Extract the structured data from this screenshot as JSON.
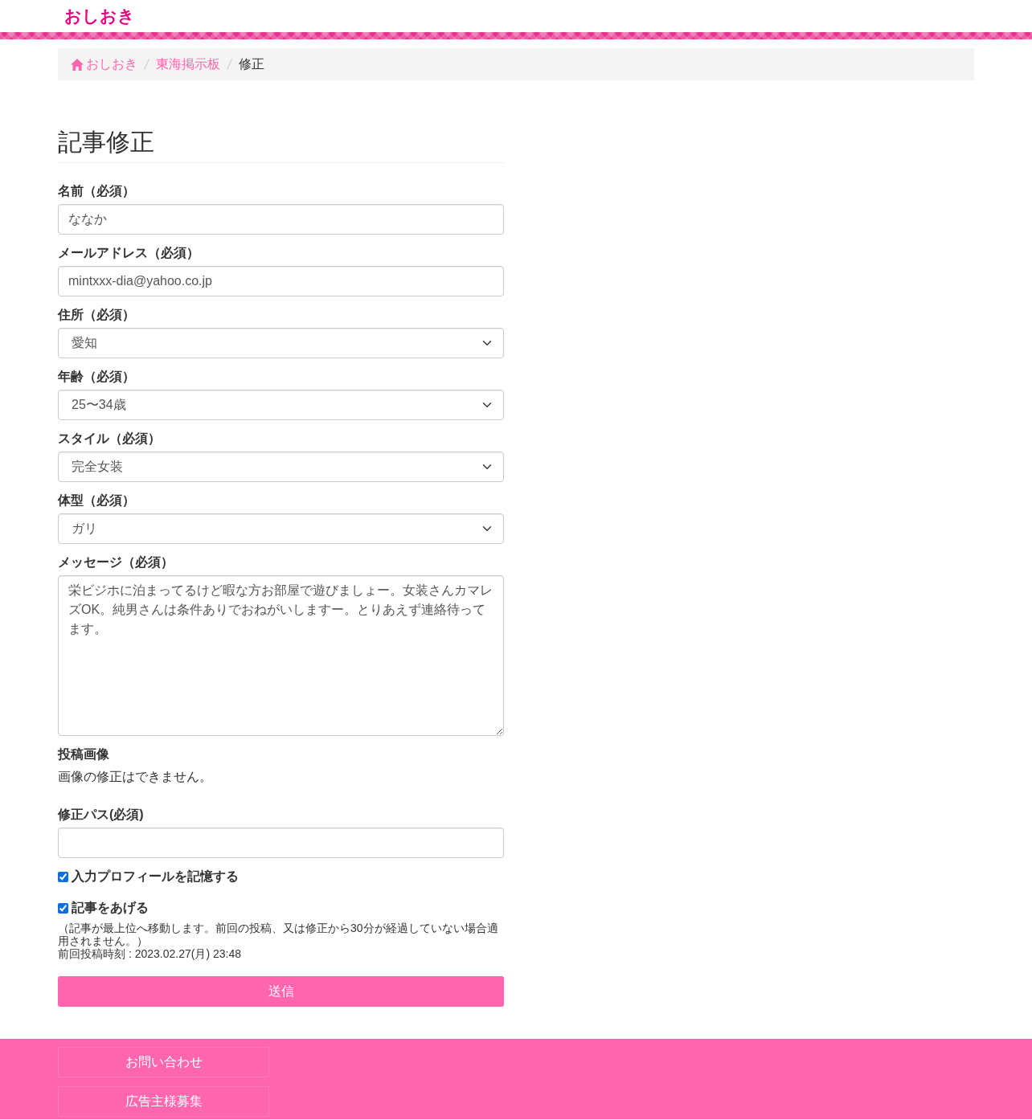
{
  "header": {
    "logo": "おしおき"
  },
  "breadcrumb": [
    {
      "label": "おしおき",
      "kind": "home"
    },
    {
      "label": "東海掲示板",
      "kind": "link"
    },
    {
      "label": "修正",
      "kind": "current"
    }
  ],
  "form": {
    "title": "記事修正",
    "fields": [
      {
        "kind": "text",
        "label": "名前（必須）",
        "value": "ななか"
      },
      {
        "kind": "text",
        "label": "メールアドレス（必須）",
        "value": "mintxxx-dia@yahoo.co.jp"
      },
      {
        "kind": "select",
        "label": "住所（必須）",
        "value": "愛知"
      },
      {
        "kind": "select",
        "label": "年齢（必須）",
        "value": "25〜34歳"
      },
      {
        "kind": "select",
        "label": "スタイル（必須）",
        "value": "完全女装"
      },
      {
        "kind": "select",
        "label": "体型（必須）",
        "value": "ガリ"
      },
      {
        "kind": "textarea",
        "label": "メッセージ（必須）",
        "value": "栄ビジホに泊まってるけど暇な方お部屋で遊びましょー。女装さんカマレズOK。純男さんは条件ありでおねがいしますー。とりあえず連絡待ってます。"
      },
      {
        "kind": "note",
        "label": "投稿画像",
        "text": "画像の修正はできません。"
      },
      {
        "kind": "password",
        "label": "修正パス(必須)"
      }
    ],
    "checkboxes": [
      {
        "label": "入力プロフィールを記憶する",
        "checked": true
      },
      {
        "label": "記事をあげる",
        "checked": true,
        "note": "（記事が最上位へ移動します。前回の投稿、又は修正から30分が経過していない場合適用されません。）",
        "last_post": "前回投稿時刻 : 2023.02.27(月) 23:48"
      }
    ],
    "submit": "送信"
  },
  "footer": {
    "links": [
      "お問い合わせ",
      "広告主様募集"
    ]
  }
}
